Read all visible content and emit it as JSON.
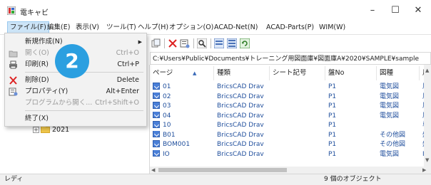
{
  "window": {
    "title": "電キャビ",
    "minimize": "–",
    "maximize": "☐",
    "close": "✕"
  },
  "menu": [
    "ファイル(F)",
    "編集(E)",
    "表示(V)",
    "ツール(T)",
    "ヘルプ(H)",
    "オプション(O)",
    "ACAD-Net(N)",
    "ACAD-Parts(P)",
    "WIM(W)"
  ],
  "path": "C:¥Users¥Public¥Documents¥トレーニング用図面庫¥図面庫A¥2020¥SAMPLE¥sample",
  "tree": {
    "node_label": "2021",
    "expander": "+"
  },
  "columns": [
    "ページ",
    "種類",
    "シート記号",
    "盤No",
    "図種",
    "用紙"
  ],
  "sort_indicator": "▲",
  "rows": [
    {
      "page": "01",
      "type": "BricsCAD Drav",
      "sheet": "",
      "board": "P1",
      "kind": "電気図",
      "paper": "展開接続図用"
    },
    {
      "page": "02",
      "type": "BricsCAD Drav",
      "sheet": "",
      "board": "P1",
      "kind": "電気図",
      "paper": "展開接続図用"
    },
    {
      "page": "03",
      "type": "BricsCAD Drav",
      "sheet": "",
      "board": "P1",
      "kind": "電気図",
      "paper": "展開接続図用"
    },
    {
      "page": "04",
      "type": "BricsCAD Drav",
      "sheet": "",
      "board": "P1",
      "kind": "電気図",
      "paper": "展開接続図用"
    },
    {
      "page": "10",
      "type": "BricsCAD Drav",
      "sheet": "",
      "board": "P1",
      "kind": "",
      "paper": "単線結線図用"
    },
    {
      "page": "B01",
      "type": "BricsCAD Drav",
      "sheet": "",
      "board": "P1",
      "kind": "その他図",
      "paper": "盤図用A3横"
    },
    {
      "page": "BOM001",
      "type": "BricsCAD Drav",
      "sheet": "",
      "board": "P1",
      "kind": "その他図",
      "paper": "盤図用A3横"
    },
    {
      "page": "IO",
      "type": "BricsCAD Drav",
      "sheet": "",
      "board": "P1",
      "kind": "電気図",
      "paper": "IO図用A3横"
    }
  ],
  "file_menu": {
    "new": {
      "label": "新規作成(N)"
    },
    "open": {
      "label": "開く(O)",
      "shortcut": "Ctrl+O"
    },
    "print": {
      "label": "印刷(R)",
      "shortcut": "Ctrl+P"
    },
    "delete": {
      "label": "削除(D)",
      "shortcut": "Delete"
    },
    "properties": {
      "label": "プロパティ(Y)",
      "shortcut": "Alt+Enter"
    },
    "open_with": {
      "label": "プログラムから開く...",
      "shortcut": "Ctrl+Shift+O"
    },
    "exit": {
      "label": "終了(X)"
    }
  },
  "step_badge": "2",
  "status": {
    "left": "レディ",
    "right": "9 個のオブジェクト"
  },
  "colors": {
    "badge": "#2b9fe0",
    "link_text": "#1f4e9c",
    "menu_highlight": "#cce4f7"
  },
  "icons": [
    "app-icon",
    "sort-arrow-icon",
    "drawing-file-icon",
    "folder-icon",
    "delete-x-icon",
    "print-icon",
    "open-icon",
    "properties-icon"
  ]
}
